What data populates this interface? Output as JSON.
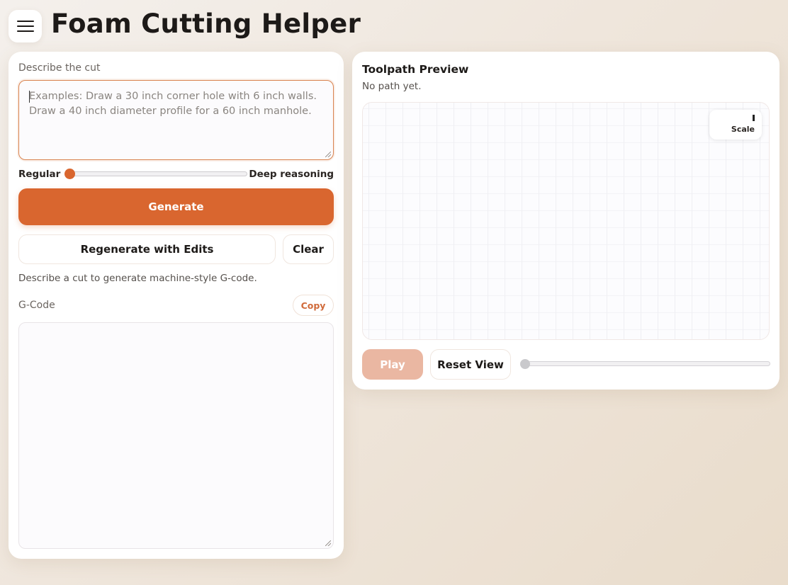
{
  "app": {
    "title": "Foam Cutting Helper"
  },
  "left_panel": {
    "describe_label": "Describe the cut",
    "prompt_placeholder": "Examples: Draw a 30 inch corner hole with 6 inch walls.\nDraw a 40 inch diameter profile for a 60 inch manhole.",
    "prompt_value": "",
    "reasoning": {
      "left_label": "Regular",
      "right_label": "Deep reasoning",
      "value": 0
    },
    "generate_label": "Generate",
    "regenerate_label": "Regenerate with Edits",
    "clear_label": "Clear",
    "status_text": "Describe a cut to generate machine-style G-code.",
    "gcode_label": "G-Code",
    "copy_label": "Copy",
    "gcode_value": ""
  },
  "right_panel": {
    "title": "Toolpath Preview",
    "subtitle": "No path yet.",
    "scale_label": "Scale",
    "play_label": "Play",
    "reset_label": "Reset View",
    "progress": 0
  },
  "colors": {
    "accent": "#d9662f",
    "accent_disabled": "#eab7a2",
    "background": "#efe6dc"
  },
  "icons": {
    "menu": "hamburger-menu-icon"
  }
}
